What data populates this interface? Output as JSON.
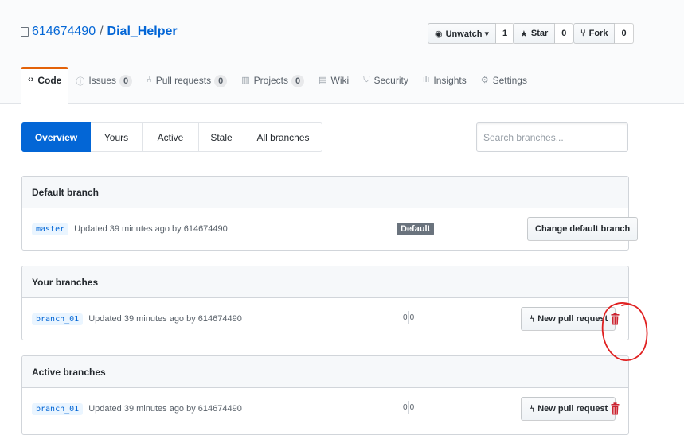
{
  "repo": {
    "owner": "614674490",
    "separator": "/",
    "name": "Dial_Helper"
  },
  "actions": {
    "watch_label": "Unwatch ▾",
    "watch_count": "1",
    "star_label": "Star",
    "star_count": "0",
    "fork_label": "Fork",
    "fork_count": "0"
  },
  "nav": {
    "code": "Code",
    "issues": "Issues",
    "issues_count": "0",
    "pull_requests": "Pull requests",
    "pull_requests_count": "0",
    "projects": "Projects",
    "projects_count": "0",
    "wiki": "Wiki",
    "security": "Security",
    "insights": "Insights",
    "settings": "Settings"
  },
  "subnav": {
    "overview": "Overview",
    "yours": "Yours",
    "active": "Active",
    "stale": "Stale",
    "all": "All branches"
  },
  "search": {
    "placeholder": "Search branches..."
  },
  "default_branch": {
    "header": "Default branch",
    "branch": "master",
    "updated": "Updated 39 minutes ago by 614674490",
    "label": "Default",
    "change_button": "Change default branch"
  },
  "your_branches": {
    "header": "Your branches",
    "branch": "branch_01",
    "updated": "Updated 39 minutes ago by 614674490",
    "behind": "0",
    "ahead": "0",
    "pr_button": "New pull request"
  },
  "active_branches": {
    "header": "Active branches",
    "branch": "branch_01",
    "updated": "Updated 39 minutes ago by 614674490",
    "behind": "0",
    "ahead": "0",
    "pr_button": "New pull request"
  },
  "colors": {
    "link": "#0366d6",
    "selected_tab_border": "#e36209",
    "delete_icon": "#cb2431",
    "annotation": "#e02020"
  }
}
